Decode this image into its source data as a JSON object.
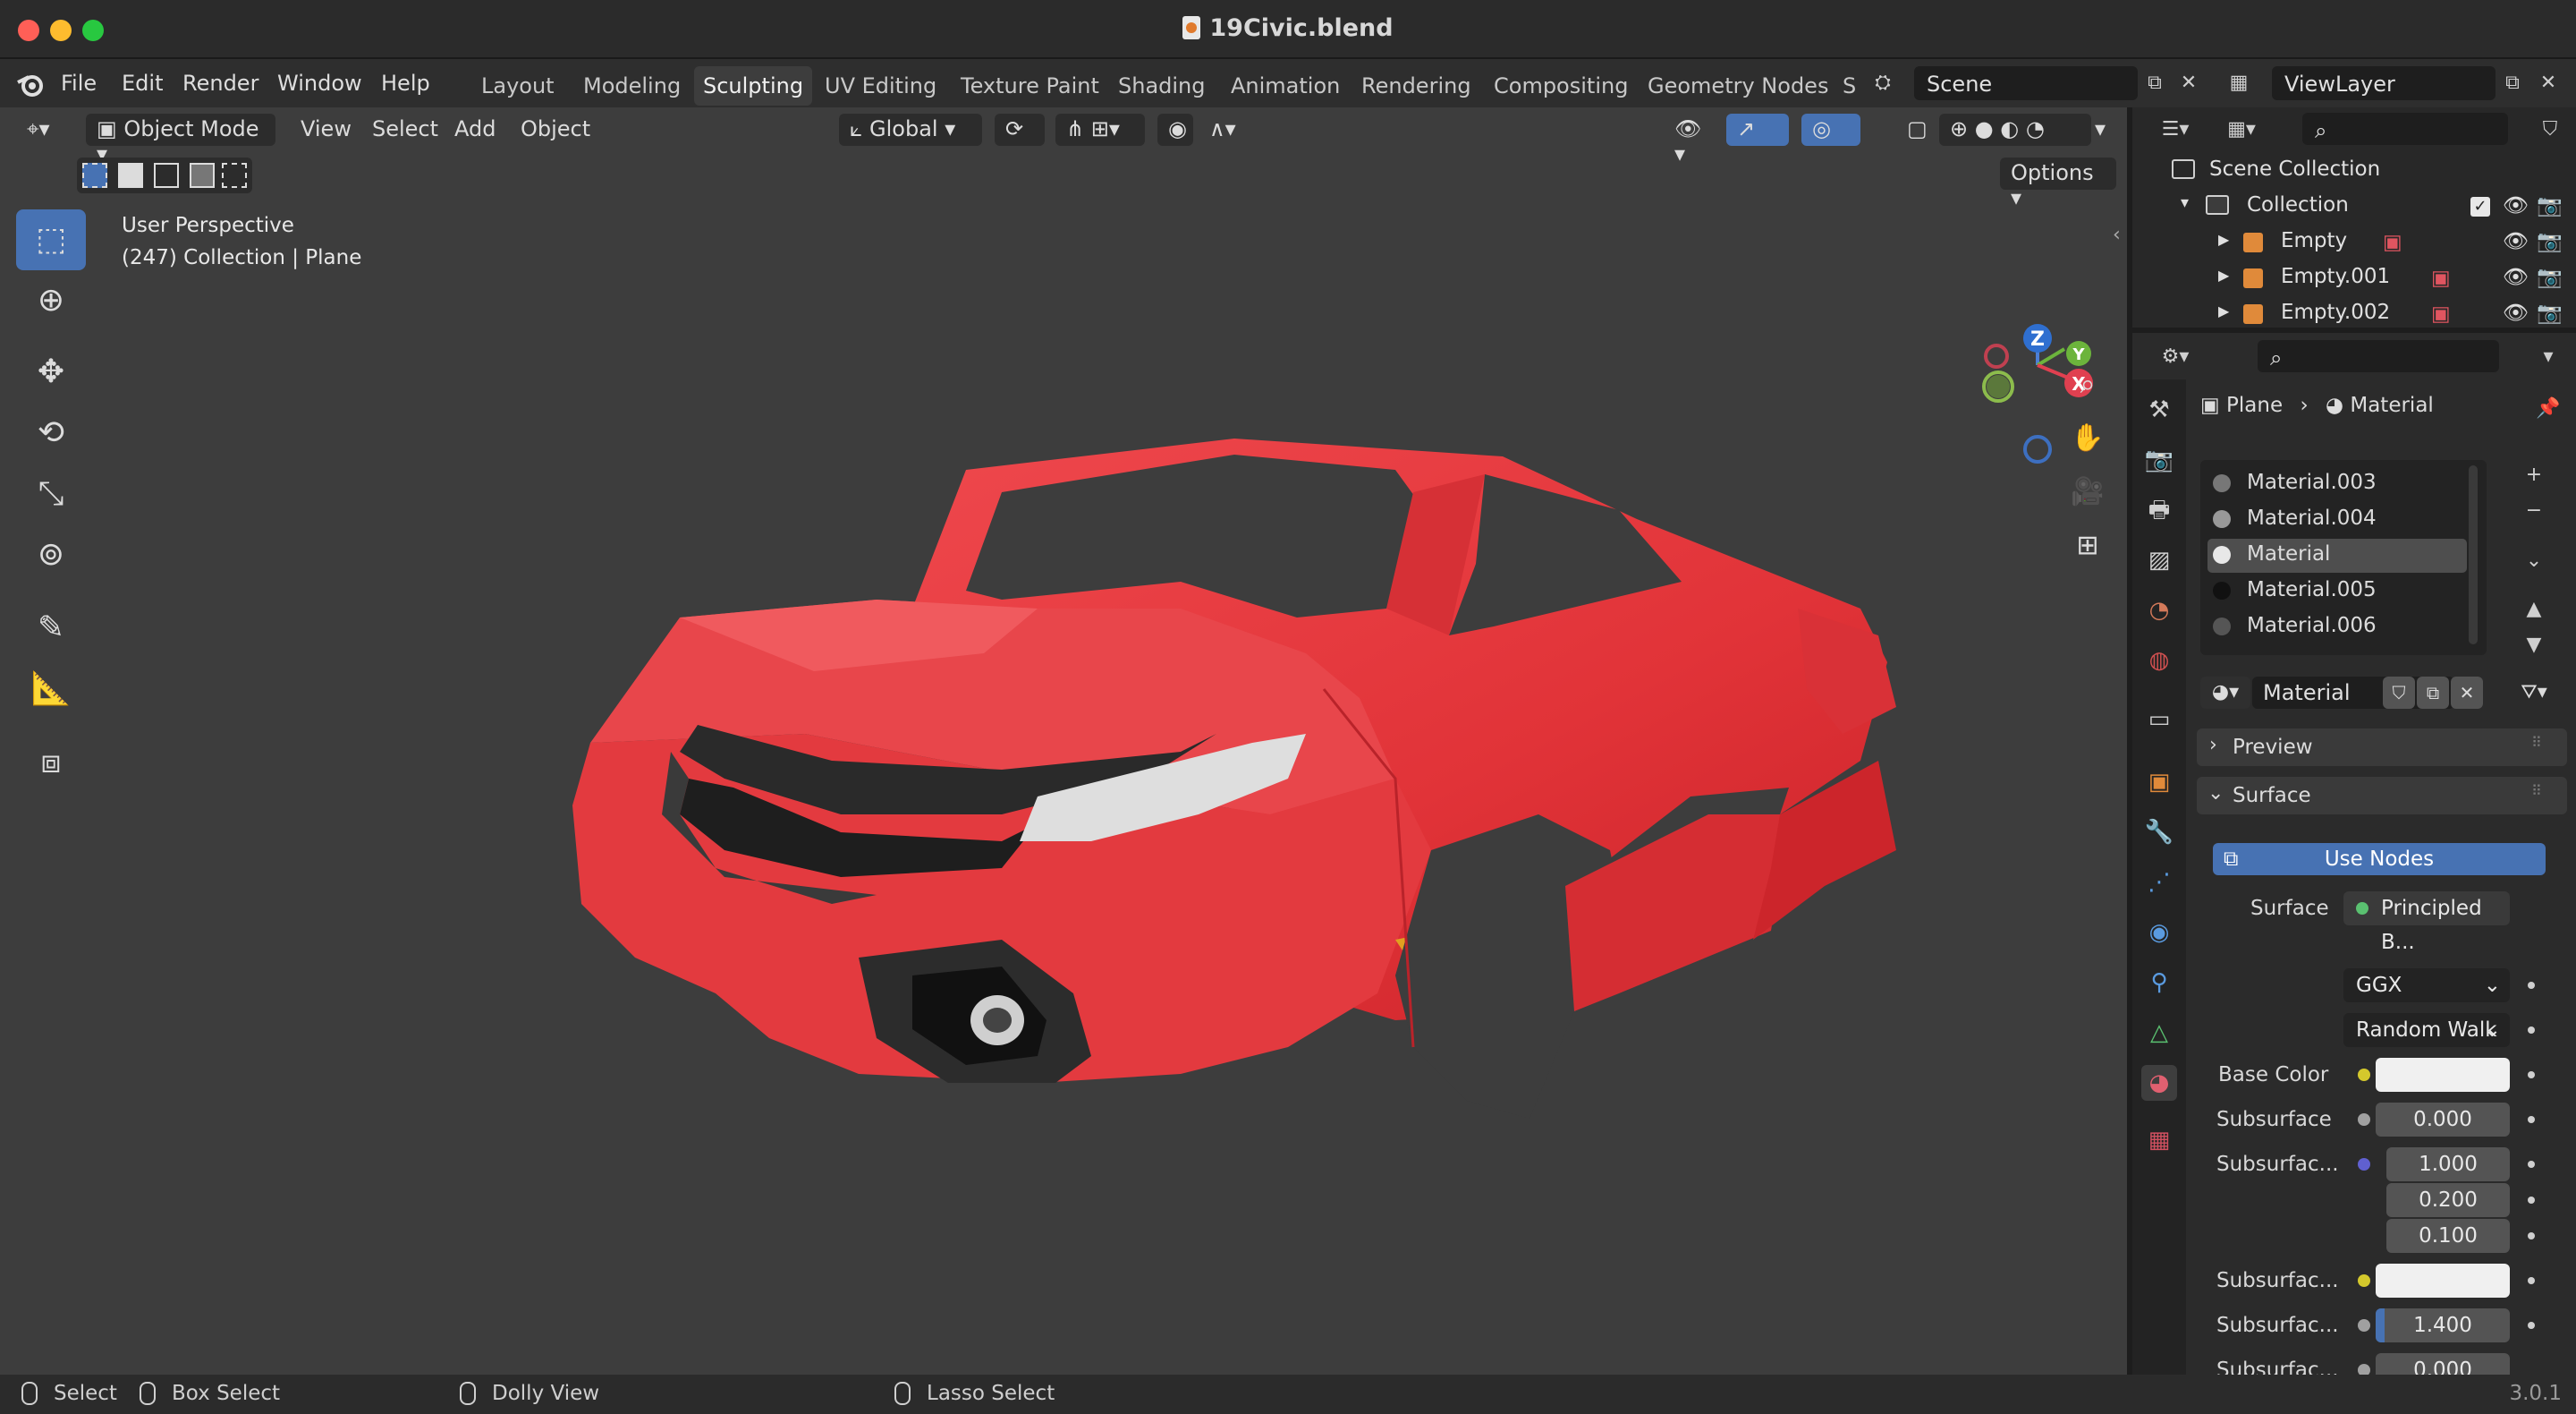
{
  "window": {
    "title": "19Civic.blend"
  },
  "menu": [
    "File",
    "Edit",
    "Render",
    "Window",
    "Help"
  ],
  "workspaces": [
    "Layout",
    "Modeling",
    "Sculpting",
    "UV Editing",
    "Texture Paint",
    "Shading",
    "Animation",
    "Rendering",
    "Compositing",
    "Geometry Nodes",
    "S"
  ],
  "active_workspace": "Sculpting",
  "scene": {
    "name": "Scene"
  },
  "view_layer": {
    "name": "ViewLayer"
  },
  "viewport": {
    "mode": "Object Mode",
    "menus": [
      "View",
      "Select",
      "Add",
      "Object"
    ],
    "transform_orientation": "Global",
    "options_label": "Options",
    "info_line1": "User Perspective",
    "info_line2": "(247) Collection | Plane",
    "gizmo_labels": {
      "z": "Z",
      "y": "Y",
      "x": "X"
    }
  },
  "outliner": {
    "root": "Scene Collection",
    "collection": "Collection",
    "items": [
      "Empty",
      "Empty.001",
      "Empty.002"
    ]
  },
  "properties": {
    "breadcrumb_object": "Plane",
    "breadcrumb_material": "Material",
    "materials": [
      "Material.003",
      "Material.004",
      "Material",
      "Material.005",
      "Material.006"
    ],
    "selected_material": "Material",
    "material_name": "Material",
    "preview_label": "Preview",
    "surface_label": "Surface",
    "use_nodes": "Use Nodes",
    "surface_field_label": "Surface",
    "surface_shader": "Principled B...",
    "distribution": "GGX",
    "subsurface_method": "Random Walk",
    "base_color_label": "Base Color",
    "subsurface_label": "Subsurface",
    "subsurface_value": "0.000",
    "subsurface_radius_label": "Subsurfac...",
    "subsurface_radius": [
      "1.000",
      "0.200",
      "0.100"
    ],
    "subsurface_color_label": "Subsurfac...",
    "subsurface_ior_label": "Subsurfac...",
    "subsurface_ior": "1.400",
    "subsurface_aniso_label": "Subsurfac...",
    "subsurface_aniso": "0.000"
  },
  "status_bar": {
    "select": "Select",
    "box_select": "Box Select",
    "dolly_view": "Dolly View",
    "lasso_select": "Lasso Select",
    "version": "3.0.1"
  },
  "colors": {
    "accent": "#4772b3",
    "viewport_bg": "#3d3d3d",
    "car_body": "#e8373c"
  }
}
